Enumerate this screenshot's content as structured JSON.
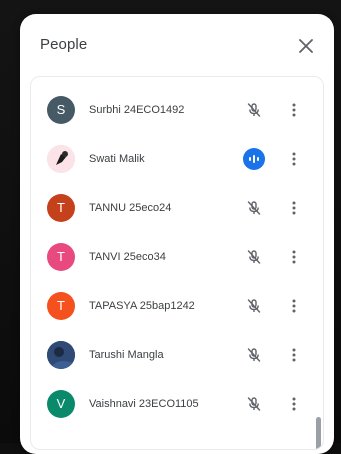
{
  "panel": {
    "title": "People",
    "close_icon": "close-icon"
  },
  "participants": [
    {
      "name": "Surbhi 24ECO1492",
      "initial": "S",
      "avatar_color": "#455a64",
      "mic_state": "muted"
    },
    {
      "name": "Swati Malik",
      "initial": "",
      "avatar_color": "#f8d7da",
      "avatar_type": "photo",
      "mic_state": "speaking"
    },
    {
      "name": "TANNU 25eco24",
      "initial": "T",
      "avatar_color": "#c5411b",
      "mic_state": "muted"
    },
    {
      "name": "TANVI 25eco34",
      "initial": "T",
      "avatar_color": "#e84a7f",
      "mic_state": "muted"
    },
    {
      "name": "TAPASYA 25bap1242",
      "initial": "T",
      "avatar_color": "#f4511e",
      "mic_state": "muted"
    },
    {
      "name": "Tarushi Mangla",
      "initial": "",
      "avatar_color": "#2f4a75",
      "avatar_type": "photo",
      "mic_state": "muted"
    },
    {
      "name": "Vaishnavi 23ECO1105",
      "initial": "V",
      "avatar_color": "#0b8a6b",
      "mic_state": "muted"
    }
  ],
  "colors": {
    "speaking_accent": "#1a73e8",
    "muted_icon": "#5f6368"
  }
}
